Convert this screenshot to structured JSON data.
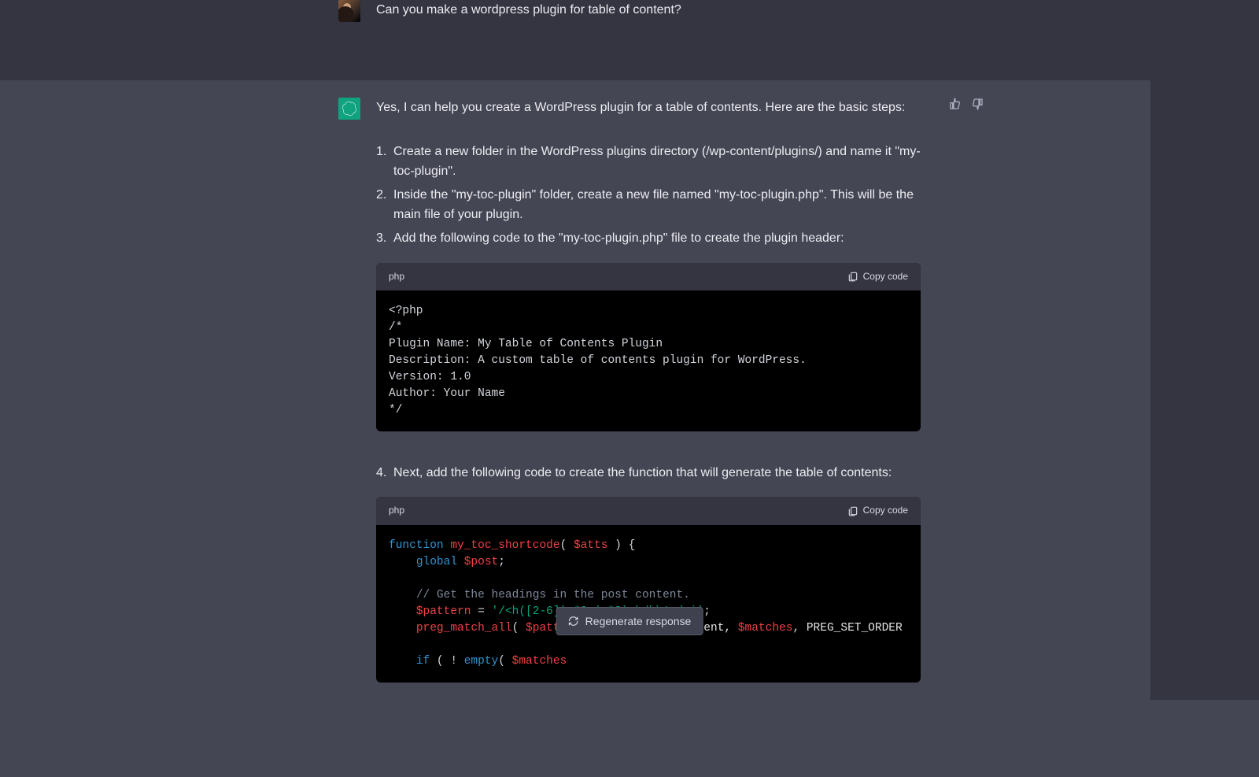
{
  "user": {
    "prompt": "Can you make a wordpress plugin for table of content?"
  },
  "assistant": {
    "intro": "Yes, I can help you create a WordPress plugin for a table of contents. Here are the basic steps:",
    "steps123": [
      "Create a new folder in the WordPress plugins directory (/wp-content/plugins/) and name it \"my-toc-plugin\".",
      "Inside the \"my-toc-plugin\" folder, create a new file named \"my-toc-plugin.php\". This will be the main file of your plugin.",
      "Add the following code to the \"my-toc-plugin.php\" file to create the plugin header:"
    ],
    "step4": "Next, add the following code to create the function that will generate the table of contents:",
    "code1": {
      "lang": "php",
      "copy_label": "Copy code",
      "lines": {
        "l1": "<?php",
        "l2": "/*",
        "l3": "Plugin Name: My Table of Contents Plugin",
        "l4": "Description: A custom table of contents plugin for WordPress.",
        "l5": "Version: 1.0",
        "l6": "Author: Your Name",
        "l7": "*/"
      }
    },
    "code2": {
      "lang": "php",
      "copy_label": "Copy code",
      "tokens": {
        "kw_function": "function",
        "fn_name": "my_toc_shortcode",
        "paren_open": "( ",
        "var_atts": "$atts",
        "paren_close_brace": " ) {",
        "kw_global": "global",
        "var_post": "$post",
        "semi": ";",
        "cmt_headings": "// Get the headings in the post content.",
        "var_pattern": "$pattern",
        "eq": " = ",
        "str_regex": "'/<h([2-6]).*?>(.*?)<\\/h\\1>/si'",
        "fn_pregmatch": "preg_match_all",
        "open_args": "( ",
        "comma_sp": ", ",
        "arrow_postcontent": "->post_content, ",
        "var_matches": "$matches",
        "str_pregset": "PREG_SET_ORDER",
        "kw_if": "if",
        "open_if": " ( ! ",
        "fn_empty": "empty",
        "open_empty": "( "
      }
    }
  },
  "ui": {
    "regenerate_label": "Regenerate response"
  }
}
